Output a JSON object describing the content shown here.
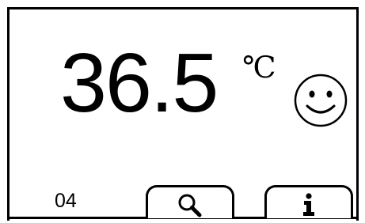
{
  "display": {
    "temperature": "36.5",
    "unit": "℃",
    "status_icon": "smiley-face-icon"
  },
  "footer": {
    "counter": "04",
    "buttons": [
      {
        "icon": "search-icon"
      },
      {
        "icon": "info-icon"
      }
    ]
  }
}
